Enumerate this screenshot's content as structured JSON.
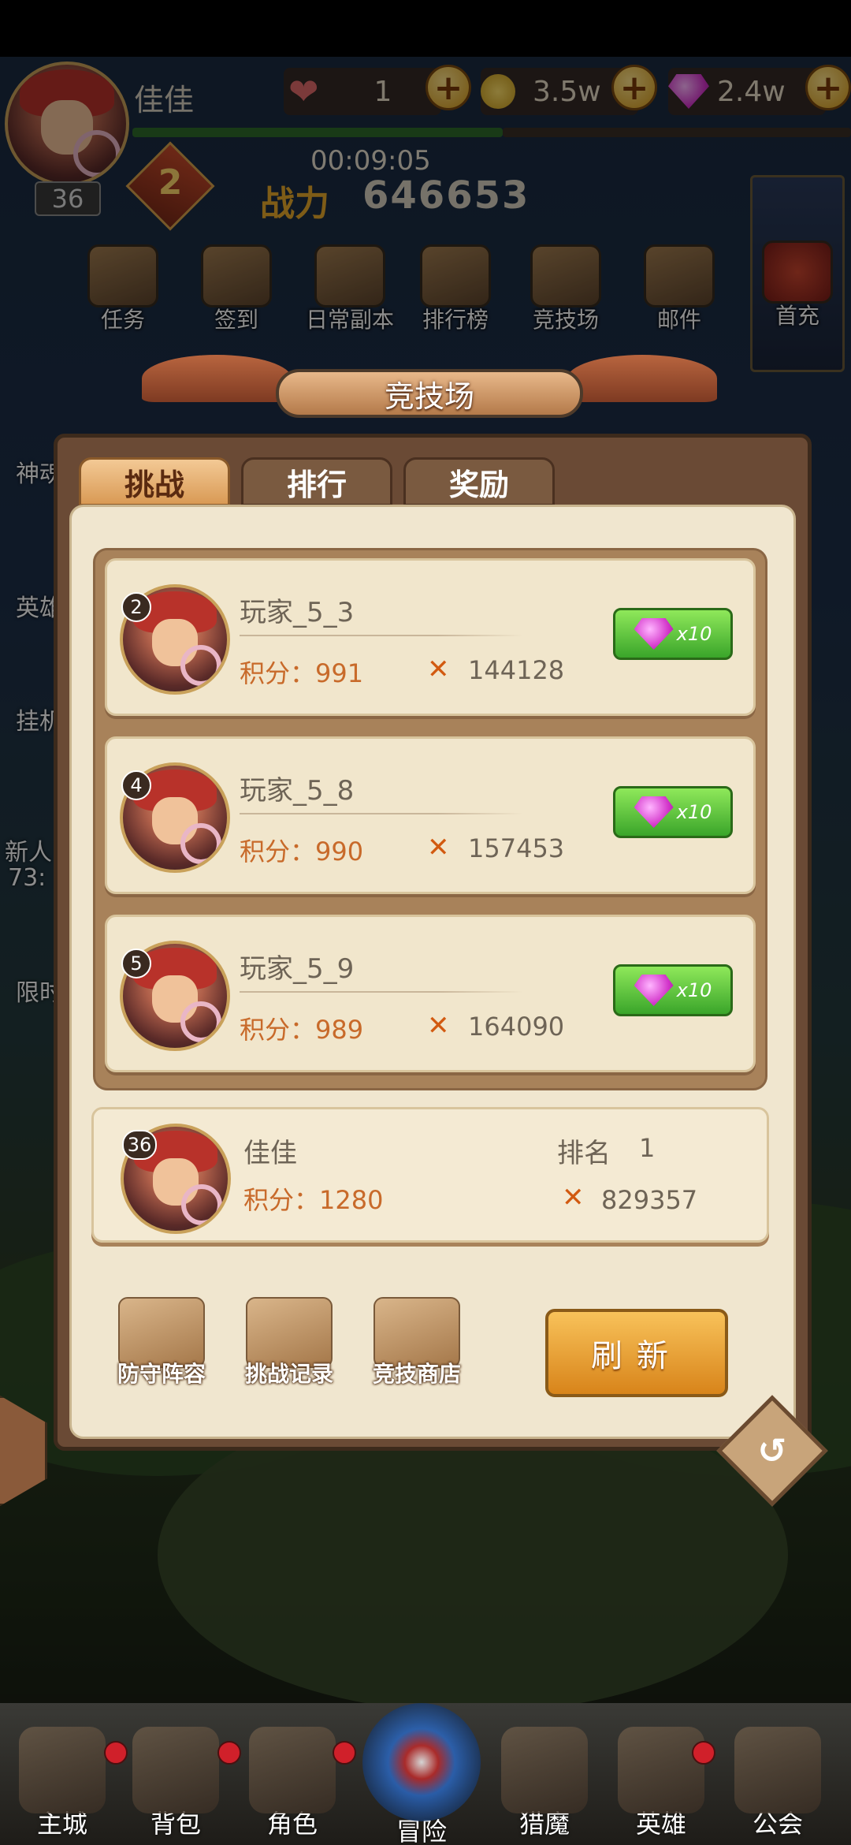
{
  "hud": {
    "player_name": "佳佳",
    "level": "36",
    "vip": "2",
    "hearts": "1",
    "gold": "3.5w",
    "gems": "2.4w",
    "timer": "00:09:05",
    "power_label": "战力",
    "power": "646653"
  },
  "top_icons": [
    {
      "label": "任务"
    },
    {
      "label": "签到"
    },
    {
      "label": "日常副本"
    },
    {
      "label": "排行榜"
    },
    {
      "label": "竞技场"
    },
    {
      "label": "邮件"
    },
    {
      "label": "首充"
    }
  ],
  "side_labels": [
    "神魂",
    "英雄",
    "挂机",
    "新人",
    "73:",
    "限时"
  ],
  "panel": {
    "title": "竞技场",
    "tabs": [
      {
        "label": "挑战",
        "active": true
      },
      {
        "label": "排行",
        "active": false
      },
      {
        "label": "奖励",
        "active": false
      }
    ],
    "opponents": [
      {
        "rank": "2",
        "name": "玩家_5_3",
        "score": "积分：991",
        "power": "144128",
        "reward": "x10"
      },
      {
        "rank": "4",
        "name": "玩家_5_8",
        "score": "积分：990",
        "power": "157453",
        "reward": "x10"
      },
      {
        "rank": "5",
        "name": "玩家_5_9",
        "score": "积分：989",
        "power": "164090",
        "reward": "x10"
      }
    ],
    "me": {
      "level": "36",
      "name": "佳佳",
      "score": "积分：1280",
      "rank_label": "排名",
      "rank": "1",
      "power": "829357"
    },
    "tools": [
      {
        "label": "防守阵容"
      },
      {
        "label": "挑战记录"
      },
      {
        "label": "竞技商店"
      }
    ],
    "refresh_label": "刷新"
  },
  "bottom_nav": [
    {
      "label": "主城"
    },
    {
      "label": "背包"
    },
    {
      "label": "角色"
    },
    {
      "label": "冒险"
    },
    {
      "label": "猎魔"
    },
    {
      "label": "英雄"
    },
    {
      "label": "公会"
    }
  ],
  "colors": {
    "panel_bg": "#f0e6cf",
    "panel_frame": "#6a4a35",
    "score_orange": "#c86a2a",
    "reward_green": "#3aa52a"
  }
}
